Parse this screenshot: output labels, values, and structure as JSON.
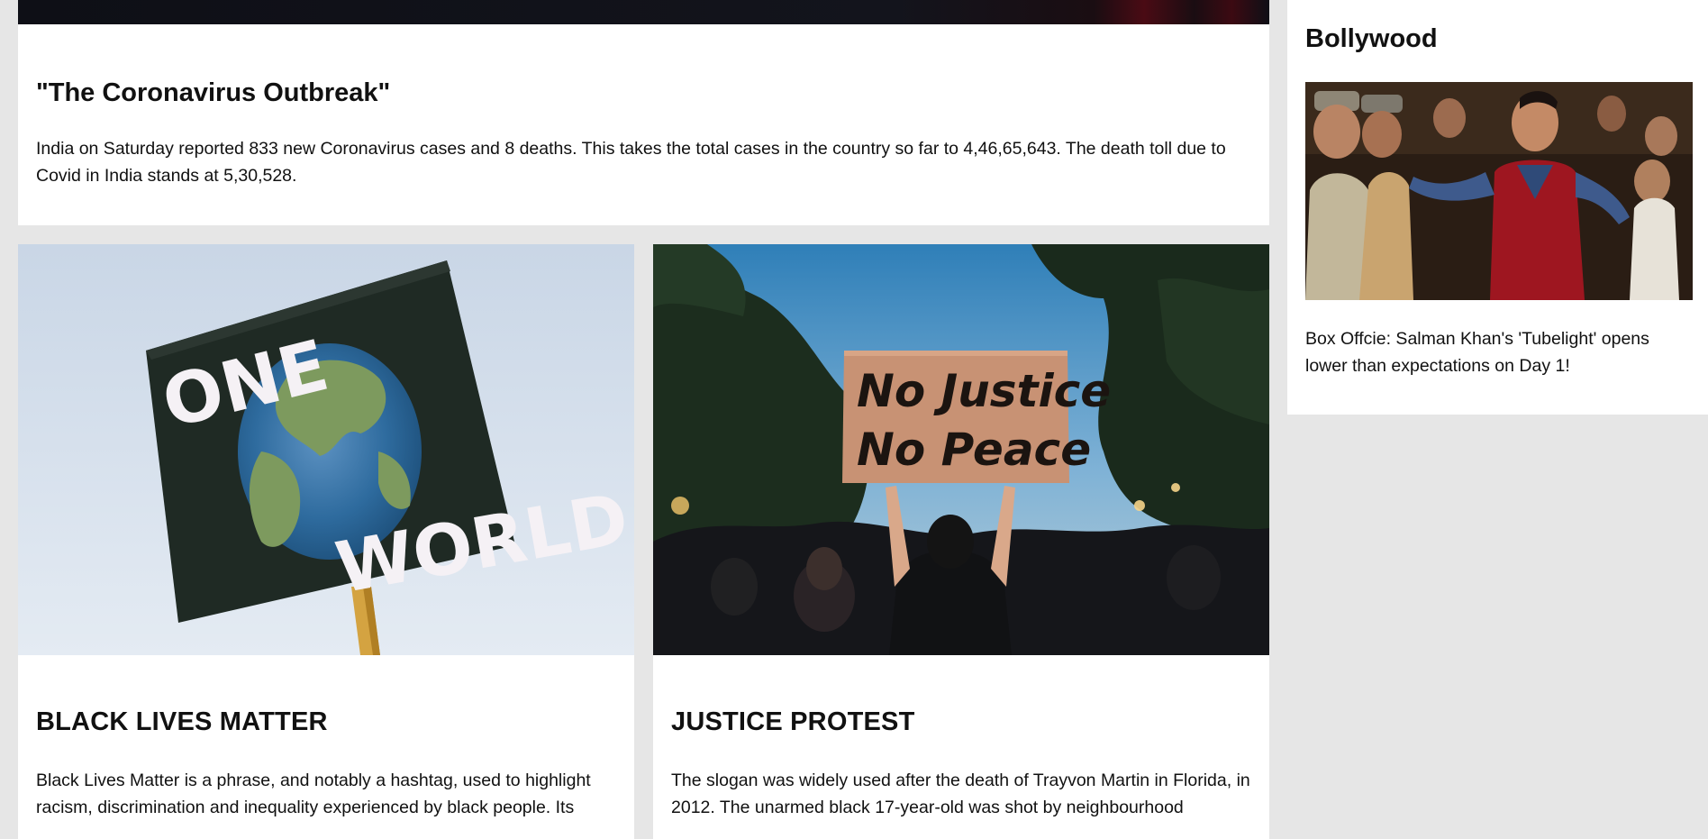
{
  "featured": {
    "title": "\"The Coronavirus Outbreak\"",
    "body": "India on Saturday reported 833 new Coronavirus cases and 8 deaths. This takes the total cases in the country so far to 4,46,65,643. The death toll due to Covid in India stands at 5,30,528."
  },
  "articles": [
    {
      "title": "BLACK LIVES MATTER",
      "body": "Black Lives Matter is a phrase, and notably a hashtag, used to highlight racism, discrimination and inequality experienced by black people. Its",
      "image": {
        "subject": "placard-one-world-icon",
        "sign_line1": "ONE",
        "sign_line2": "WORLD"
      }
    },
    {
      "title": "JUSTICE PROTEST",
      "body": "The slogan was widely used after the death of Trayvon Martin in Florida, in 2012. The unarmed black 17-year-old was shot by neighbourhood",
      "image": {
        "subject": "protest-crowd-icon",
        "sign_line1": "No Justice",
        "sign_line2": "No Peace"
      }
    }
  ],
  "sidebar": {
    "title": "Bollywood",
    "body": "Box Offcie: Salman Khan's 'Tubelight' opens lower than expectations on Day 1!",
    "image": {
      "subject": "bollywood-dance-scene-icon"
    }
  },
  "colors": {
    "page_background": "#e6e6e6",
    "card_background": "#ffffff",
    "text": "#111111"
  }
}
